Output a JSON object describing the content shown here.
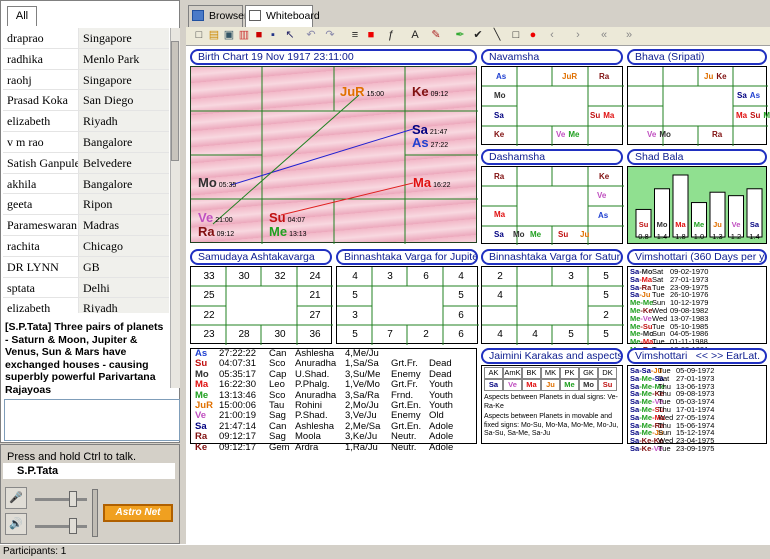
{
  "left": {
    "tab": "All",
    "users": [
      [
        "draprao",
        "Singapore"
      ],
      [
        "radhika",
        "Menlo Park"
      ],
      [
        "raohj",
        "Singapore"
      ],
      [
        "Prasad Koka",
        "San Diego"
      ],
      [
        "elizabeth",
        "Riyadh"
      ],
      [
        "v m rao",
        "Bangalore"
      ],
      [
        "Satish Ganpule",
        "Belvedere"
      ],
      [
        "akhila",
        "Bangalore"
      ],
      [
        "geeta",
        "Ripon"
      ],
      [
        "Parameswaran",
        "Madras"
      ],
      [
        "rachita",
        "Chicago"
      ],
      [
        "DR LYNN",
        "GB"
      ],
      [
        "sptata",
        "Delhi"
      ],
      [
        "elizabeth",
        "Riyadh"
      ]
    ],
    "chat": "[S.P.Tata] Three pairs of planets - Saturn & Moon, Jupiter & Venus, Sun & Mars have exchanged houses - causing superbly powerful Parivartana Rajayoas",
    "talk_label": "Press and hold Ctrl to talk.",
    "talk_user": "S.P.Tata",
    "logo": "Astro Net"
  },
  "status": "Participants: 1",
  "tabs": [
    "Browser",
    "Whiteboard"
  ],
  "birth_chart": {
    "title": "Birth Chart  19 Nov 1917  23:11:00",
    "planets": [
      {
        "n": "JuR",
        "d": "15:00",
        "c": "#e07000"
      },
      {
        "n": "Ke",
        "d": "09:12",
        "c": "#801010"
      },
      {
        "n": "Sa",
        "d": "21:47",
        "c": "#000080"
      },
      {
        "n": "As",
        "d": "27:22",
        "c": "#2040d0"
      },
      {
        "n": "Mo",
        "d": "05:35",
        "c": "#303030"
      },
      {
        "n": "Ma",
        "d": "16:22",
        "c": "#e01010"
      },
      {
        "n": "Ve",
        "d": "21:00",
        "c": "#c050c0"
      },
      {
        "n": "Ra",
        "d": "09:12",
        "c": "#801010"
      },
      {
        "n": "Su",
        "d": "04:07",
        "c": "#c01010"
      },
      {
        "n": "Me",
        "d": "13:13",
        "c": "#20a020"
      }
    ]
  },
  "navamsha": {
    "title": "Navamsha",
    "cells": [
      "As",
      "JuR",
      "Ra",
      "Mo",
      "Sa",
      "Su Ma",
      "Ke",
      "Ve Me"
    ]
  },
  "bhava": {
    "title": "Bhava (Sripati)",
    "cells": [
      "Ju Ke",
      "Sa As",
      "Ve Mo",
      "Ra",
      "Ma Su Me"
    ]
  },
  "dashamsha": {
    "title": "Dashamsha",
    "cells": [
      "Ra",
      "Ke",
      "Ve",
      "Ma",
      "Sa",
      "Me",
      "Su",
      "Ju",
      "As",
      "Mo"
    ]
  },
  "shadbala": {
    "title": "Shad Bala",
    "labels": [
      "Su",
      "Mo",
      "Ma",
      "Me",
      "Ju",
      "Ve",
      "Sa"
    ],
    "values": [
      "0.8",
      "1.4",
      "1.8",
      "1.0",
      "1.3",
      "1.2",
      "1.4"
    ]
  },
  "sarvashtaka": {
    "title": "Samudaya Ashtakavarga",
    "cells": [
      "33",
      "30",
      "32",
      "24",
      "25",
      "21",
      "22",
      "27",
      "23",
      "28",
      "30",
      "36"
    ]
  },
  "binna_ju": {
    "title": "Binnashtaka Varga for Jupiter",
    "cells": [
      "4",
      "3",
      "6",
      "4",
      "5",
      "5",
      "3",
      "6",
      "5",
      "7",
      "2",
      "6"
    ]
  },
  "binna_sa": {
    "title": "Binnashtaka Varga for Saturn",
    "cells": [
      "2",
      "3",
      "5",
      "4",
      "5",
      "2",
      "4",
      "4",
      "5",
      "5"
    ]
  },
  "vimsh1": {
    "title": "Vimshottari (360 Days per year)",
    "rows": [
      [
        "Sa-Mo",
        "Sat",
        "09-02-1970"
      ],
      [
        "Sa-Ma",
        "Sat",
        "27-01-1973"
      ],
      [
        "Sa-Ra",
        "Tue",
        "23-09-1975"
      ],
      [
        "Sa-Ju",
        "Tue",
        "26-10-1976"
      ],
      [
        "Me-Me",
        "Sun",
        "10-12-1979"
      ],
      [
        "Me-Ke",
        "Wed",
        "09-08-1982"
      ],
      [
        "Me-Ve",
        "Wed",
        "13-07-1983"
      ],
      [
        "Me-Su",
        "Tue",
        "05-10-1985"
      ],
      [
        "Me-Mo",
        "Sun",
        "04-05-1986"
      ],
      [
        "Me-Ma",
        "Tue",
        "01-11-1988"
      ],
      [
        "Me-Ra",
        "Tue",
        "18-03-1991"
      ]
    ]
  },
  "vimsh2": {
    "title": "Vimshottari",
    "nav": "<< >> EarLat.",
    "rows": [
      [
        "Sa-Sa-Ju",
        "Tue",
        "05-09-1972"
      ],
      [
        "Sa-Me-Sa",
        "Sat",
        "27-01-1973"
      ],
      [
        "Sa-Me-Me",
        "Thu",
        "13-06-1973"
      ],
      [
        "Sa-Me-Ke",
        "Thu",
        "09-08-1973"
      ],
      [
        "Sa-Me-Ve",
        "Tue",
        "05-03-1974"
      ],
      [
        "Sa-Me-Su",
        "Thu",
        "17-01-1974"
      ],
      [
        "Sa-Me-Ma",
        "Wed",
        "27-05-1974"
      ],
      [
        "Sa-Me-Ra",
        "Thu",
        "15-06-1974"
      ],
      [
        "Sa-Me-Ju",
        "Sun",
        "15-12-1974"
      ],
      [
        "Sa-Ke-Ke",
        "Wed",
        "23-04-1975"
      ],
      [
        "Sa-Ke-Ve",
        "Tue",
        "23-09-1975"
      ]
    ]
  },
  "planet_table": [
    [
      "As",
      "27:22:22",
      "Can",
      "Ashlesha",
      "4,Me/Ju",
      "",
      ""
    ],
    [
      "Su",
      "04:07:31",
      "Sco",
      "Anuradha",
      "1,Sa/Sa",
      "Grt.Fr.",
      "Dead"
    ],
    [
      "Mo",
      "05:35:17",
      "Cap",
      "U.Shad.",
      "3,Su/Me",
      "Enemy",
      "Dead"
    ],
    [
      "Ma",
      "16:22:30",
      "Leo",
      "P.Phalg.",
      "1,Ve/Mo",
      "Grt.Fr.",
      "Youth"
    ],
    [
      "Me",
      "13:13:46",
      "Sco",
      "Anuradha",
      "3,Sa/Ra",
      "Frnd.",
      "Youth"
    ],
    [
      "JuR",
      "15:00:06",
      "Tau",
      "Rohini",
      "2,Mo/Ju",
      "Grt.En.",
      "Youth"
    ],
    [
      "Ve",
      "21:00:19",
      "Sag",
      "P.Shad.",
      "3,Ve/Ju",
      "Enemy",
      "Old"
    ],
    [
      "Sa",
      "21:47:14",
      "Can",
      "Ashlesha",
      "2,Me/Sa",
      "Grt.En.",
      "Adole"
    ],
    [
      "Ra",
      "09:12:17",
      "Sag",
      "Moola",
      "3,Ke/Ju",
      "Neutr.",
      "Adole"
    ],
    [
      "Ke",
      "09:12:17",
      "Gem",
      "Ardra",
      "1,Ra/Ju",
      "Neutr.",
      "Adole"
    ]
  ],
  "jaimini": {
    "title": "Jaimini Karakas and aspects",
    "heads": [
      "AK",
      "AmK",
      "BK",
      "MK",
      "PK",
      "GK",
      "DK"
    ],
    "vals": [
      "Sa",
      "Ve",
      "Ma",
      "Ju",
      "Me",
      "Mo",
      "Su"
    ],
    "text1": "Aspects between Planets in dual signs: Ve-Ra-Ke",
    "text2": "Aspects between Planets in movable and fixed signs: Mo-Su, Mo-Ma, Mo-Me, Mo-Ju, Sa-Su, Sa-Me, Sa-Ju"
  },
  "colors": {
    "As": "#2040d0",
    "Su": "#c01010",
    "Mo": "#303030",
    "Ma": "#e01010",
    "Me": "#20a020",
    "JuR": "#e07000",
    "Ju": "#e07000",
    "Ve": "#c050c0",
    "Sa": "#000080",
    "Ra": "#801010",
    "Ke": "#801010"
  }
}
